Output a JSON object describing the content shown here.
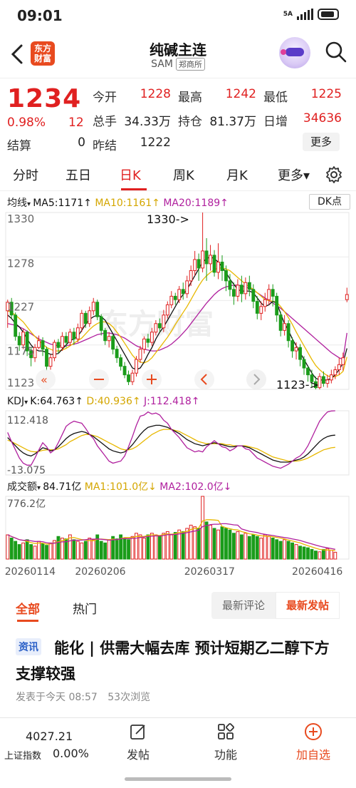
{
  "status_bar": {
    "time": "09:01",
    "network": "5A"
  },
  "header": {
    "logo_line1": "东方",
    "logo_line2": "财富",
    "title": "纯碱主连",
    "code": "SAM",
    "exchange": "郑商所"
  },
  "quote": {
    "price": "1234",
    "change_pct": "0.98%",
    "change": "12",
    "settle_label": "结算",
    "settle_value": "0",
    "today_open_label": "今开",
    "today_open": "1228",
    "high_label": "最高",
    "high": "1242",
    "low_label": "最低",
    "low": "1225",
    "volume_label": "总手",
    "volume": "34.33万",
    "open_interest_label": "持仓",
    "open_interest": "81.37万",
    "daily_increase_label": "日增",
    "daily_increase": "34636",
    "prev_settle_label": "昨结",
    "prev_settle": "1222",
    "more_label": "更多"
  },
  "period_tabs": [
    {
      "label": "分时"
    },
    {
      "label": "五日"
    },
    {
      "label": "日K",
      "active": true
    },
    {
      "label": "周K"
    },
    {
      "label": "月K"
    },
    {
      "label": "更多▾"
    }
  ],
  "chart": {
    "ma_legend": {
      "name": "均线",
      "ma5": "MA5:1171",
      "ma10": "MA10:1161",
      "ma20": "MA20:1189",
      "arrow": "↑"
    },
    "dk_label": "DK点",
    "y_labels": [
      "1330",
      "1278",
      "1227",
      "1175",
      "1123"
    ],
    "max_annotation": "1330->",
    "min_annotation": "1123->",
    "watermark": "东方财富",
    "kdj_legend": {
      "name": "KDJ",
      "k": "K:64.763",
      "d": "D:40.936",
      "j": "J:112.418",
      "arrow": "↑"
    },
    "kdj_max": "112.418",
    "kdj_min": "-13.075",
    "vol_legend": {
      "name": "成交额",
      "value": "84.71亿",
      "ma1": "MA1:101.0亿",
      "ma2": "MA2:102.0亿",
      "arrow": "↓"
    },
    "vol_max": "776.2亿",
    "dates": [
      "20260114",
      "20260206",
      "20260317",
      "20260416"
    ],
    "colors": {
      "up": "#e02020",
      "down": "#1a9c1a",
      "ma5": "#111111",
      "ma10": "#e8b800",
      "ma20": "#b0209e"
    }
  },
  "chart_data": {
    "type": "candlestick",
    "ylim": [
      1123,
      1330
    ],
    "dates": [
      "20260114",
      "20260206",
      "20260317",
      "20260416"
    ],
    "candles": [
      [
        1215,
        1225,
        1195,
        1228
      ],
      [
        1225,
        1210,
        1205,
        1230
      ],
      [
        1210,
        1185,
        1180,
        1213
      ],
      [
        1185,
        1175,
        1168,
        1190
      ],
      [
        1175,
        1190,
        1170,
        1194
      ],
      [
        1190,
        1168,
        1162,
        1192
      ],
      [
        1168,
        1160,
        1150,
        1172
      ],
      [
        1160,
        1172,
        1155,
        1176
      ],
      [
        1172,
        1180,
        1170,
        1186
      ],
      [
        1180,
        1170,
        1162,
        1184
      ],
      [
        1170,
        1150,
        1145,
        1173
      ],
      [
        1150,
        1160,
        1146,
        1164
      ],
      [
        1160,
        1178,
        1156,
        1181
      ],
      [
        1178,
        1172,
        1165,
        1182
      ],
      [
        1172,
        1185,
        1168,
        1190
      ],
      [
        1185,
        1178,
        1172,
        1190
      ],
      [
        1178,
        1190,
        1174,
        1194
      ],
      [
        1190,
        1182,
        1175,
        1195
      ],
      [
        1182,
        1195,
        1178,
        1200
      ],
      [
        1195,
        1212,
        1190,
        1216
      ],
      [
        1212,
        1200,
        1195,
        1215
      ],
      [
        1200,
        1215,
        1196,
        1220
      ],
      [
        1215,
        1225,
        1210,
        1230
      ],
      [
        1225,
        1208,
        1204,
        1228
      ],
      [
        1208,
        1192,
        1186,
        1211
      ],
      [
        1192,
        1180,
        1175,
        1195
      ],
      [
        1180,
        1185,
        1172,
        1190
      ],
      [
        1185,
        1170,
        1164,
        1188
      ],
      [
        1170,
        1160,
        1154,
        1174
      ],
      [
        1160,
        1150,
        1145,
        1164
      ],
      [
        1150,
        1140,
        1136,
        1155
      ],
      [
        1140,
        1132,
        1128,
        1145
      ],
      [
        1132,
        1142,
        1128,
        1146
      ],
      [
        1142,
        1158,
        1138,
        1162
      ],
      [
        1158,
        1170,
        1154,
        1174
      ],
      [
        1170,
        1182,
        1165,
        1185
      ],
      [
        1182,
        1178,
        1172,
        1188
      ],
      [
        1178,
        1190,
        1174,
        1195
      ],
      [
        1190,
        1200,
        1186,
        1204
      ],
      [
        1200,
        1195,
        1190,
        1206
      ],
      [
        1195,
        1210,
        1190,
        1216
      ],
      [
        1210,
        1222,
        1206,
        1226
      ],
      [
        1222,
        1232,
        1218,
        1238
      ],
      [
        1232,
        1228,
        1222,
        1236
      ],
      [
        1228,
        1240,
        1224,
        1244
      ],
      [
        1240,
        1235,
        1228,
        1248
      ],
      [
        1235,
        1250,
        1230,
        1256
      ],
      [
        1250,
        1262,
        1244,
        1268
      ],
      [
        1262,
        1275,
        1256,
        1285
      ],
      [
        1275,
        1265,
        1250,
        1282
      ],
      [
        1265,
        1285,
        1260,
        1330
      ],
      [
        1285,
        1270,
        1250,
        1300
      ],
      [
        1270,
        1280,
        1262,
        1292
      ],
      [
        1280,
        1260,
        1255,
        1286
      ],
      [
        1260,
        1272,
        1252,
        1294
      ],
      [
        1272,
        1262,
        1250,
        1280
      ],
      [
        1262,
        1250,
        1238,
        1268
      ],
      [
        1250,
        1240,
        1232,
        1258
      ],
      [
        1240,
        1232,
        1222,
        1248
      ],
      [
        1232,
        1245,
        1226,
        1252
      ],
      [
        1245,
        1235,
        1225,
        1256
      ],
      [
        1235,
        1248,
        1228,
        1254
      ],
      [
        1248,
        1240,
        1232,
        1256
      ],
      [
        1240,
        1226,
        1218,
        1246
      ],
      [
        1226,
        1212,
        1205,
        1232
      ],
      [
        1212,
        1220,
        1204,
        1226
      ],
      [
        1220,
        1228,
        1214,
        1236
      ],
      [
        1228,
        1240,
        1222,
        1246
      ],
      [
        1240,
        1232,
        1220,
        1246
      ],
      [
        1232,
        1210,
        1202,
        1236
      ],
      [
        1210,
        1192,
        1185,
        1214
      ],
      [
        1192,
        1200,
        1186,
        1210
      ],
      [
        1200,
        1180,
        1172,
        1204
      ],
      [
        1180,
        1168,
        1160,
        1184
      ],
      [
        1168,
        1172,
        1158,
        1178
      ],
      [
        1172,
        1158,
        1150,
        1176
      ],
      [
        1158,
        1148,
        1140,
        1162
      ],
      [
        1148,
        1140,
        1132,
        1150
      ],
      [
        1140,
        1132,
        1126,
        1146
      ],
      [
        1132,
        1125,
        1123,
        1138
      ],
      [
        1125,
        1138,
        1123,
        1142
      ],
      [
        1138,
        1130,
        1126,
        1144
      ],
      [
        1130,
        1134,
        1125,
        1140
      ],
      [
        1134,
        1140,
        1130,
        1146
      ],
      [
        1140,
        1146,
        1135,
        1150
      ],
      [
        1146,
        1152,
        1140,
        1160
      ],
      [
        1152,
        1160,
        1145,
        1166
      ],
      [
        1228,
        1234,
        1225,
        1242
      ]
    ],
    "ma5": [
      1210,
      1206,
      1200,
      1196,
      1190,
      1182,
      1175,
      1170,
      1168,
      1168,
      1166,
      1164,
      1164,
      1165,
      1170,
      1175,
      1180,
      1182,
      1185,
      1192,
      1199,
      1205,
      1208,
      1210,
      1208,
      1204,
      1196,
      1188,
      1180,
      1172,
      1164,
      1156,
      1148,
      1146,
      1148,
      1155,
      1164,
      1172,
      1182,
      1190,
      1196,
      1204,
      1212,
      1220,
      1228,
      1234,
      1240,
      1248,
      1256,
      1264,
      1272,
      1276,
      1278,
      1276,
      1272,
      1266,
      1260,
      1252,
      1246,
      1240,
      1238,
      1238,
      1238,
      1236,
      1230,
      1224,
      1220,
      1222,
      1226,
      1224,
      1212,
      1200,
      1192,
      1182,
      1174,
      1166,
      1158,
      1150,
      1142,
      1136,
      1134,
      1134,
      1134,
      1136,
      1140,
      1146,
      1154,
      1171
    ],
    "ma10": [
      1215,
      1213,
      1210,
      1206,
      1202,
      1196,
      1190,
      1185,
      1180,
      1176,
      1172,
      1170,
      1168,
      1168,
      1169,
      1171,
      1174,
      1177,
      1180,
      1183,
      1188,
      1193,
      1197,
      1200,
      1202,
      1202,
      1200,
      1196,
      1190,
      1184,
      1177,
      1170,
      1163,
      1158,
      1155,
      1154,
      1156,
      1160,
      1166,
      1172,
      1178,
      1184,
      1191,
      1199,
      1206,
      1213,
      1220,
      1228,
      1236,
      1244,
      1251,
      1256,
      1260,
      1263,
      1265,
      1265,
      1264,
      1262,
      1258,
      1254,
      1250,
      1246,
      1243,
      1240,
      1236,
      1232,
      1228,
      1227,
      1226,
      1225,
      1220,
      1214,
      1207,
      1199,
      1190,
      1182,
      1174,
      1166,
      1158,
      1151,
      1146,
      1142,
      1139,
      1137,
      1138,
      1140,
      1144,
      1161
    ],
    "ma20": [
      1200,
      1199,
      1198,
      1196,
      1194,
      1191,
      1188,
      1185,
      1182,
      1180,
      1178,
      1176,
      1175,
      1174,
      1174,
      1174,
      1175,
      1176,
      1177,
      1179,
      1181,
      1183,
      1185,
      1187,
      1188,
      1189,
      1189,
      1188,
      1187,
      1185,
      1183,
      1180,
      1177,
      1174,
      1172,
      1170,
      1169,
      1168,
      1168,
      1169,
      1171,
      1173,
      1176,
      1180,
      1184,
      1189,
      1194,
      1200,
      1206,
      1212,
      1218,
      1224,
      1229,
      1234,
      1238,
      1241,
      1243,
      1244,
      1245,
      1245,
      1244,
      1243,
      1241,
      1239,
      1236,
      1233,
      1230,
      1227,
      1224,
      1221,
      1218,
      1214,
      1210,
      1206,
      1202,
      1198,
      1194,
      1190,
      1186,
      1182,
      1178,
      1174,
      1170,
      1166,
      1163,
      1160,
      1158,
      1189
    ],
    "kdj_ylim": [
      -13.075,
      112.418
    ],
    "k": [
      60,
      52,
      44,
      36,
      30,
      26,
      24,
      28,
      34,
      40,
      38,
      34,
      36,
      42,
      50,
      58,
      64,
      68,
      70,
      72,
      70,
      66,
      62,
      56,
      50,
      44,
      38,
      34,
      32,
      30,
      32,
      38,
      46,
      56,
      66,
      74,
      80,
      82,
      84,
      84,
      82,
      80,
      76,
      72,
      68,
      62,
      56,
      52,
      48,
      46,
      44,
      46,
      48,
      50,
      48,
      46,
      44,
      42,
      42,
      44,
      44,
      42,
      40,
      36,
      32,
      28,
      24,
      20,
      16,
      14,
      12,
      12,
      12,
      14,
      16,
      18,
      22,
      28,
      36,
      44,
      52,
      58,
      62,
      64,
      64.763
    ],
    "d": [
      55,
      52,
      48,
      44,
      40,
      36,
      33,
      32,
      33,
      35,
      36,
      36,
      36,
      38,
      42,
      46,
      52,
      56,
      60,
      64,
      66,
      66,
      64,
      62,
      58,
      54,
      50,
      46,
      42,
      38,
      36,
      36,
      38,
      42,
      48,
      54,
      60,
      66,
      70,
      74,
      76,
      76,
      76,
      74,
      72,
      68,
      64,
      60,
      56,
      52,
      50,
      48,
      48,
      48,
      48,
      48,
      46,
      46,
      44,
      44,
      44,
      44,
      42,
      40,
      38,
      34,
      30,
      26,
      22,
      20,
      18,
      16,
      14,
      14,
      14,
      15,
      17,
      20,
      24,
      28,
      32,
      36,
      38,
      40,
      40.936
    ],
    "j": [
      70,
      52,
      36,
      20,
      10,
      6,
      6,
      20,
      36,
      50,
      42,
      30,
      36,
      50,
      66,
      82,
      88,
      92,
      90,
      88,
      78,
      66,
      58,
      44,
      34,
      24,
      14,
      10,
      12,
      14,
      24,
      42,
      62,
      84,
      102,
      104,
      110,
      106,
      108,
      104,
      94,
      88,
      76,
      68,
      60,
      50,
      40,
      36,
      32,
      34,
      32,
      42,
      48,
      54,
      48,
      42,
      40,
      34,
      38,
      44,
      44,
      38,
      36,
      28,
      20,
      16,
      12,
      8,
      4,
      2,
      0,
      4,
      8,
      14,
      20,
      24,
      32,
      44,
      60,
      76,
      92,
      102,
      110,
      112,
      112.418
    ],
    "amount": [
      300,
      260,
      220,
      180,
      200,
      240,
      180,
      160,
      220,
      190,
      170,
      200,
      230,
      280,
      260,
      250,
      300,
      240,
      220,
      200,
      220,
      260,
      240,
      300,
      220,
      200,
      240,
      280,
      250,
      300,
      260,
      240,
      280,
      320,
      300,
      260,
      300,
      320,
      300,
      280,
      320,
      340,
      300,
      330,
      360,
      340,
      380,
      420,
      400,
      380,
      776.2,
      460,
      420,
      380,
      360,
      400,
      380,
      360,
      320,
      340,
      300,
      320,
      280,
      300,
      280,
      260,
      300,
      280,
      260,
      240,
      220,
      240,
      220,
      200,
      180,
      160,
      150,
      140,
      120,
      100,
      90,
      120,
      130,
      110,
      84.71
    ],
    "amount_max": 776.2
  },
  "feed_tabs": {
    "all": "全部",
    "hot": "热门",
    "latest_comment": "最新评论",
    "latest_post": "最新发帖"
  },
  "post": {
    "tag": "资讯",
    "title": "能化 | 供需大幅去库 预计短期乙二醇下方支撑较强",
    "time": "发表于今天 08:57",
    "views": "53次浏览"
  },
  "bottom_bar": {
    "index_value": "4027.21",
    "index_name": "上证指数",
    "index_pct": "0.00%",
    "post": "发帖",
    "features": "功能",
    "watchlist": "加自选"
  }
}
